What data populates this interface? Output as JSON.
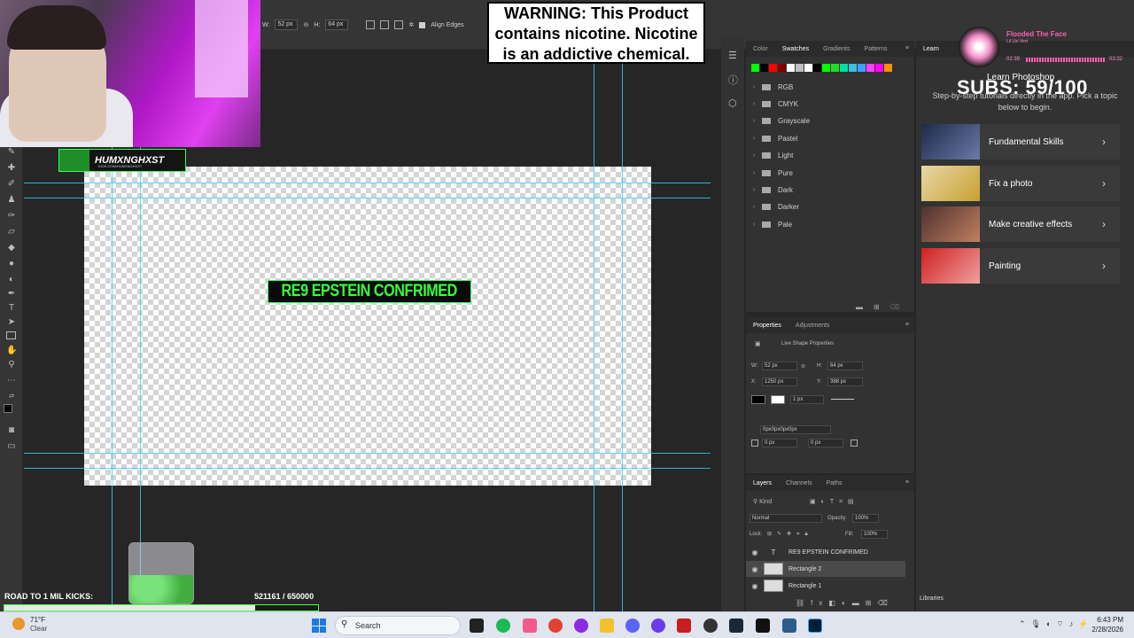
{
  "options_bar": {
    "w_label": "W:",
    "w_value": "52 px",
    "h_label": "H:",
    "h_value": "64 px",
    "align_edges_label": "Align Edges"
  },
  "warning": {
    "line1": "WARNING: This Product",
    "line2": "contains nicotine. Nicotine",
    "line3": "is an addictive chemical."
  },
  "stream": {
    "channel_name": "HUMXNGHXST",
    "channel_sub": "KICK.COM/HUMXNGHXST",
    "kicks_label": "ROAD TO 1 MIL KICKS:",
    "kicks_count": "521161  / 650000",
    "kicks_progress": 0.8,
    "subs": "SUBS: 59/100",
    "music": {
      "title": "Flooded The Face",
      "artist": "Lil Uzi Vert",
      "elapsed": "02:39",
      "total": "03:32"
    }
  },
  "canvas": {
    "headline_text": "RE9 EPSTEIN CONFRIMED",
    "headline_color": "#39ff3c"
  },
  "swatches": {
    "tabs": [
      "Color",
      "Swatches",
      "Gradients",
      "Patterns"
    ],
    "active_tab": "Swatches",
    "colors": [
      "#00ff00",
      "#000000",
      "#ff0000",
      "#800000",
      "#ffffff",
      "#c0c0c0",
      "#ffffff",
      "#000000",
      "#00ff00",
      "#22dd22",
      "#00e0a0",
      "#40c0e0",
      "#40a0ff",
      "#ff40ff",
      "#ff00ff",
      "#ff9000"
    ],
    "folders": [
      "RGB",
      "CMYK",
      "Grayscale",
      "Pastel",
      "Light",
      "Pure",
      "Dark",
      "Darker",
      "Pale"
    ]
  },
  "properties": {
    "tabs": [
      "Properties",
      "Adjustments"
    ],
    "title": "Live Shape Properties",
    "w_label": "W:",
    "w_value": "52 px",
    "h_label": "H:",
    "h_value": "64 px",
    "x_label": "X:",
    "x_value": "1250 px",
    "y_label": "Y:",
    "y_value": "388 px",
    "stroke_width": "1 px",
    "radius_value": "0px0px0px0px",
    "corner1": "0 px",
    "corner2": "0 px"
  },
  "layers": {
    "tabs": [
      "Layers",
      "Channels",
      "Paths"
    ],
    "kind_label": "Kind",
    "blend_mode": "Normal",
    "opacity_label": "Opacity:",
    "opacity_value": "100%",
    "lock_label": "Lock:",
    "fill_label": "Fill:",
    "fill_value": "100%",
    "items": [
      {
        "name": "RE9 EPSTEIN CONFRIMED",
        "type": "text"
      },
      {
        "name": "Rectangle 2",
        "type": "shape"
      },
      {
        "name": "Rectangle 1",
        "type": "shape"
      }
    ]
  },
  "learn": {
    "tab": "Learn",
    "title": "Learn Photoshop",
    "description": "Step-by-step tutorials directly in the app. Pick a topic below to begin.",
    "cards": [
      "Fundamental Skills",
      "Fix a photo",
      "Make creative effects",
      "Painting"
    ],
    "libraries": "Libraries"
  },
  "taskbar": {
    "temperature": "71°F",
    "weather": "Clear",
    "search_placeholder": "Search",
    "time": "6:43 PM",
    "date": "2/28/2026"
  }
}
